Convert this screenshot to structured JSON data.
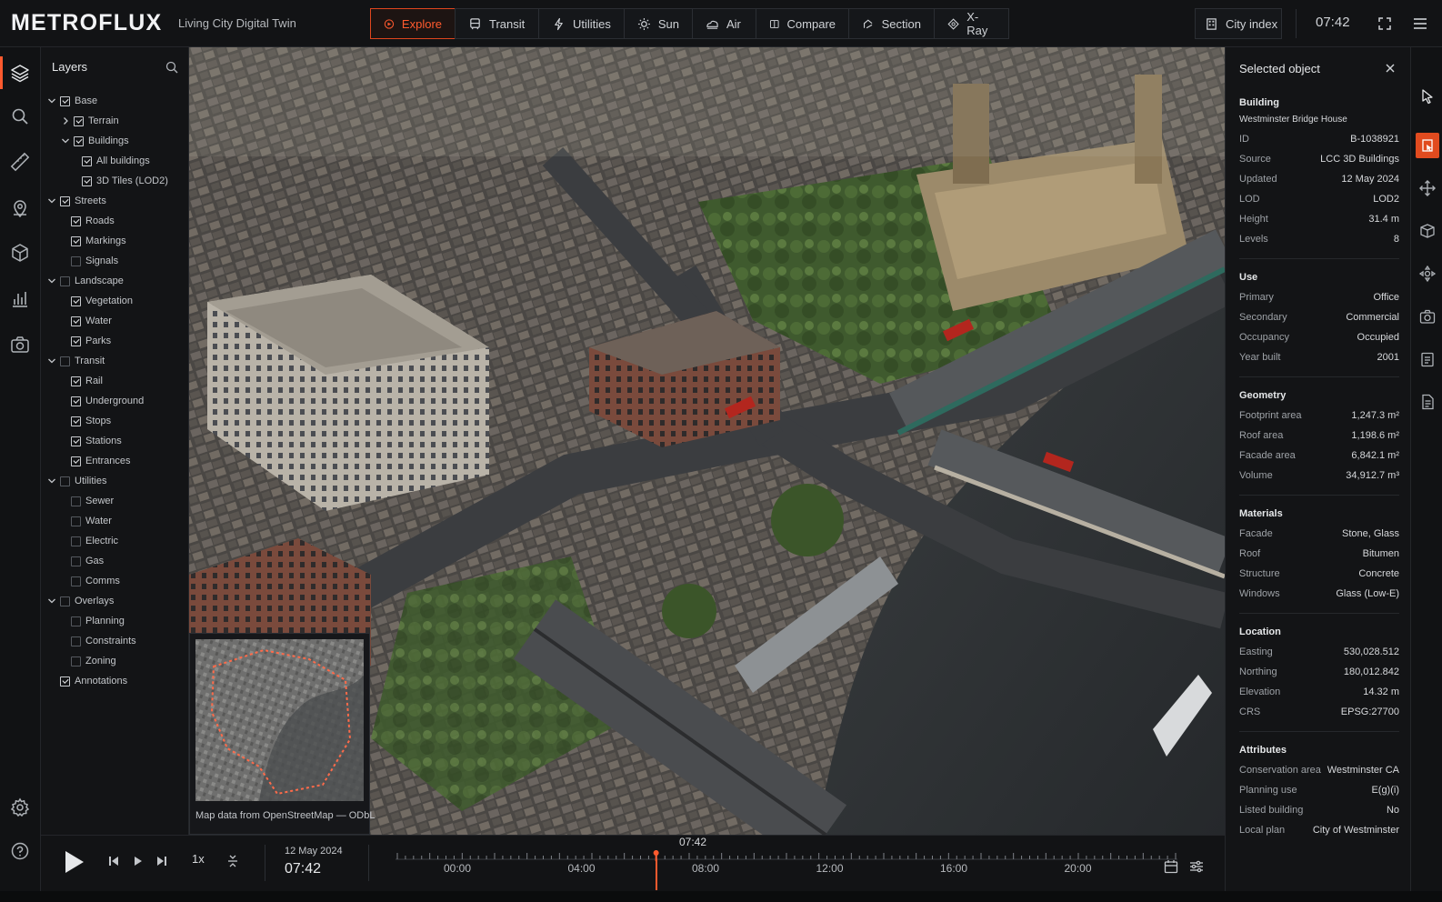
{
  "app": {
    "brand": "METROFLUX",
    "subtitle": "Living City Digital Twin",
    "accent": "#ff5a2e",
    "clock": "07:42"
  },
  "toolbar": {
    "tabs": [
      {
        "label": "Explore",
        "icon": "target-icon",
        "active": true
      },
      {
        "label": "Transit",
        "icon": "bus-icon",
        "active": false
      },
      {
        "label": "Utilities",
        "icon": "bolt-icon",
        "active": false
      },
      {
        "label": "Sun",
        "icon": "sun-icon",
        "active": false
      },
      {
        "label": "Air",
        "icon": "cloud-icon",
        "active": false
      },
      {
        "label": "Compare",
        "icon": "compare-icon",
        "active": false
      },
      {
        "label": "Section",
        "icon": "section-icon",
        "active": false
      },
      {
        "label": "X-Ray",
        "icon": "xray-icon",
        "active": false
      }
    ],
    "city_index_label": "City index"
  },
  "layers": {
    "title": "Layers",
    "tree": [
      {
        "label": "Base",
        "level": 0,
        "expanded": true,
        "checked": true
      },
      {
        "label": "Terrain",
        "level": 1,
        "expanded": false,
        "collapsedChevron": true,
        "checked": true
      },
      {
        "label": "Buildings",
        "level": 1,
        "expanded": true,
        "checked": true
      },
      {
        "label": "All buildings",
        "level": 2,
        "checked": true
      },
      {
        "label": "3D Tiles (LOD2)",
        "level": 2,
        "checked": true
      },
      {
        "label": "Streets",
        "level": 0,
        "expanded": true,
        "checked": true
      },
      {
        "label": "Roads",
        "level": 1,
        "checked": true
      },
      {
        "label": "Markings",
        "level": 1,
        "checked": true
      },
      {
        "label": "Signals",
        "level": 1,
        "checked": false
      },
      {
        "label": "Landscape",
        "level": 0,
        "expanded": true,
        "checked": false
      },
      {
        "label": "Vegetation",
        "level": 1,
        "checked": true
      },
      {
        "label": "Water",
        "level": 1,
        "checked": true
      },
      {
        "label": "Parks",
        "level": 1,
        "checked": true
      },
      {
        "label": "Transit",
        "level": 0,
        "expanded": true,
        "checked": false
      },
      {
        "label": "Rail",
        "level": 1,
        "checked": true
      },
      {
        "label": "Underground",
        "level": 1,
        "checked": true
      },
      {
        "label": "Stops",
        "level": 1,
        "checked": true
      },
      {
        "label": "Stations",
        "level": 1,
        "checked": true
      },
      {
        "label": "Entrances",
        "level": 1,
        "checked": true
      },
      {
        "label": "Utilities",
        "level": 0,
        "expanded": true,
        "checked": false
      },
      {
        "label": "Sewer",
        "level": 1,
        "checked": false
      },
      {
        "label": "Water",
        "level": 1,
        "checked": false
      },
      {
        "label": "Electric",
        "level": 1,
        "checked": false
      },
      {
        "label": "Gas",
        "level": 1,
        "checked": false
      },
      {
        "label": "Comms",
        "level": 1,
        "checked": false
      },
      {
        "label": "Overlays",
        "level": 0,
        "expanded": true,
        "checked": false
      },
      {
        "label": "Planning",
        "level": 1,
        "checked": false
      },
      {
        "label": "Constraints",
        "level": 1,
        "checked": false
      },
      {
        "label": "Zoning",
        "level": 1,
        "checked": false
      },
      {
        "label": "Annotations",
        "level": 0,
        "noChevron": true,
        "checked": true
      }
    ]
  },
  "minimap": {
    "caption": "Map data from OpenStreetMap — ODbL"
  },
  "details": {
    "title": "Selected object",
    "building_heading": "Building",
    "building_name": "Westminster Bridge House",
    "building_props": [
      {
        "k": "ID",
        "v": "B-1038921"
      },
      {
        "k": "Source",
        "v": "LCC 3D Buildings"
      },
      {
        "k": "Updated",
        "v": "12 May 2024"
      },
      {
        "k": "LOD",
        "v": "LOD2"
      },
      {
        "k": "Height",
        "v": "31.4 m"
      },
      {
        "k": "Levels",
        "v": "8"
      }
    ],
    "sections": [
      {
        "title": "Use",
        "rows": [
          {
            "k": "Primary",
            "v": "Office"
          },
          {
            "k": "Secondary",
            "v": "Commercial"
          },
          {
            "k": "Occupancy",
            "v": "Occupied"
          },
          {
            "k": "Year built",
            "v": "2001"
          }
        ]
      },
      {
        "title": "Geometry",
        "rows": [
          {
            "k": "Footprint area",
            "v": "1,247.3 m²"
          },
          {
            "k": "Roof area",
            "v": "1,198.6 m²"
          },
          {
            "k": "Facade area",
            "v": "6,842.1 m²"
          },
          {
            "k": "Volume",
            "v": "34,912.7 m³"
          }
        ]
      },
      {
        "title": "Materials",
        "rows": [
          {
            "k": "Facade",
            "v": "Stone, Glass"
          },
          {
            "k": "Roof",
            "v": "Bitumen"
          },
          {
            "k": "Structure",
            "v": "Concrete"
          },
          {
            "k": "Windows",
            "v": "Glass (Low-E)"
          }
        ]
      },
      {
        "title": "Location",
        "rows": [
          {
            "k": "Easting",
            "v": "530,028.512"
          },
          {
            "k": "Northing",
            "v": "180,012.842"
          },
          {
            "k": "Elevation",
            "v": "14.32 m"
          },
          {
            "k": "CRS",
            "v": "EPSG:27700"
          }
        ]
      },
      {
        "title": "Attributes",
        "rows": [
          {
            "k": "Conservation area",
            "v": "Westminster CA"
          },
          {
            "k": "Planning use",
            "v": "E(g)(i)"
          },
          {
            "k": "Listed building",
            "v": "No"
          },
          {
            "k": "Local plan",
            "v": "City of Westminster"
          }
        ]
      }
    ]
  },
  "timeline": {
    "speed": "1x",
    "date": "12 May 2024",
    "time": "07:42",
    "cursor_label": "07:42",
    "labels": [
      "00:00",
      "04:00",
      "08:00",
      "12:00",
      "16:00",
      "20:00"
    ]
  }
}
